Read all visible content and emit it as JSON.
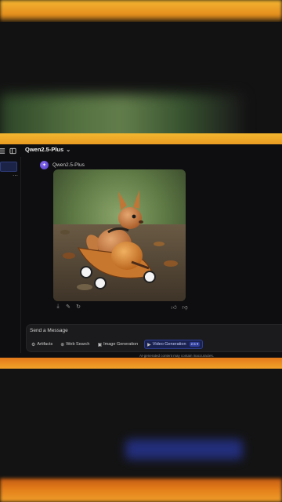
{
  "header": {
    "model_name": "Qwen2.5-Plus"
  },
  "assistant": {
    "name": "Qwen2.5-Plus"
  },
  "image_actions": {
    "left": [
      "download-icon",
      "edit-icon",
      "refresh-icon"
    ],
    "right": [
      "thumbs-up-icon",
      "thumbs-down-icon"
    ]
  },
  "composer": {
    "placeholder": "Send a Message",
    "chips": [
      {
        "label": "Artifacts",
        "icon": "artifacts-icon"
      },
      {
        "label": "Web Search",
        "icon": "globe-icon"
      },
      {
        "label": "Image Generation",
        "icon": "image-icon"
      },
      {
        "label": "Video Generation",
        "icon": "video-icon",
        "badge": "2.5 ▾",
        "active": true
      }
    ]
  },
  "disclaimer": "AI-generated content may contain inaccuracies.",
  "colors": {
    "accent": "#2e3d8e",
    "background": "#0e0e10",
    "frame_top": "#f2b62f",
    "frame_bottom": "#e4791a"
  }
}
